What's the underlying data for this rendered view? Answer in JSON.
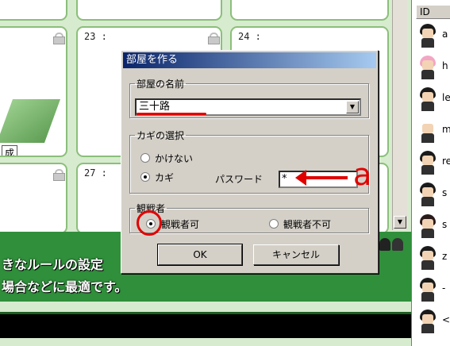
{
  "lobby": {
    "rooms": [
      {
        "number": ""
      },
      {
        "number": ""
      },
      {
        "number": ""
      },
      {
        "number": ""
      },
      {
        "number": "23 :"
      },
      {
        "number": "24 :"
      },
      {
        "number": ""
      },
      {
        "number": ""
      },
      {
        "number": "27 :"
      }
    ],
    "board_label": "成",
    "description": [
      "きなルールの設定",
      "場合などに最適です。"
    ]
  },
  "user_list": {
    "header": "ID",
    "users": [
      {
        "name": "a"
      },
      {
        "name": "h"
      },
      {
        "name": "le"
      },
      {
        "name": "m"
      },
      {
        "name": "re"
      },
      {
        "name": "s"
      },
      {
        "name": "s"
      },
      {
        "name": "z"
      },
      {
        "name": "-"
      },
      {
        "name": "<"
      }
    ]
  },
  "dialog": {
    "title": "部屋を作る",
    "room_name_group": "部屋の名前",
    "room_name_value": "三十路",
    "key_group": "カギの選択",
    "key_option_none": "かけない",
    "key_option_key": "カギ",
    "password_label": "パスワード",
    "password_value": "*",
    "watch_group": "観戦者",
    "watch_allowed": "観戦者可",
    "watch_not_allowed": "観戦者不可",
    "ok_label": "OK",
    "cancel_label": "キャンセル"
  },
  "annotation": {
    "letter": "a",
    "color": "#e10000"
  }
}
